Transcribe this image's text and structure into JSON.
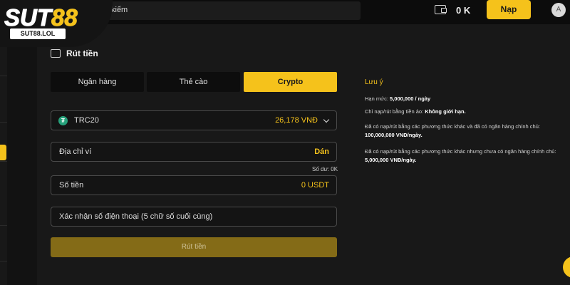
{
  "brand": {
    "logo_main": "SUT",
    "logo_accent": "88",
    "logo_sub": "SUT88.LOL"
  },
  "topbar": {
    "search_text": "kiếm",
    "balance": "0 K",
    "deposit_label": "Nạp",
    "avatar_initial": "A"
  },
  "page": {
    "title": "Rút tiền",
    "tabs": [
      {
        "label": "Ngân hàng",
        "active": false
      },
      {
        "label": "Thẻ cào",
        "active": false
      },
      {
        "label": "Crypto",
        "active": true
      }
    ],
    "network": {
      "label": "TRC20",
      "value": "26,178 VNĐ",
      "icon": "tether-icon"
    },
    "wallet_address": {
      "label": "Địa chỉ ví",
      "action": "Dán"
    },
    "balance_note": "Số dư: 0K",
    "amount": {
      "label": "Số tiền",
      "value": "0 USDT"
    },
    "phone_confirm": {
      "placeholder": "Xác nhận số điện thoại (5 chữ số cuối cùng)"
    },
    "submit_label": "Rút tiền"
  },
  "notes": {
    "title": "Lưu ý",
    "limit_label": "Hạn mức:",
    "limit_value": "5,000,000 / ngày",
    "crypto_label": "Chỉ nạp/rút bằng tiền ảo:",
    "crypto_value": "Không giới hạn.",
    "with_bank_text": "Đã có nạp/rút bằng các phương thức khác và đã có ngân hàng chính chủ:",
    "with_bank_value": "100,000,000 VNĐ/ngày.",
    "no_bank_text": "Đã có nạp/rút bằng các phương thức khác nhưng chưa có ngân hàng chính chủ:",
    "no_bank_value": "5,000,000 VNĐ/ngày."
  },
  "colors": {
    "accent": "#f5c21b",
    "background": "#121212",
    "panel": "#181818"
  }
}
